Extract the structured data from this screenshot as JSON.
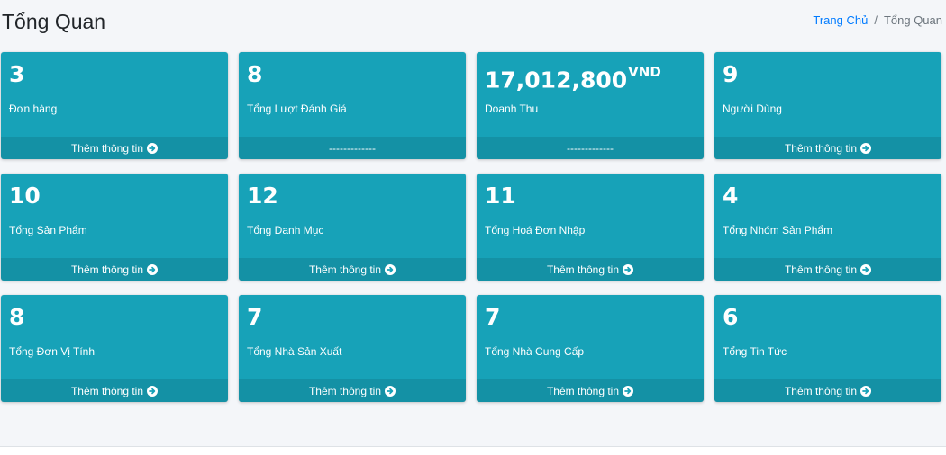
{
  "header": {
    "title": "Tổng Quan",
    "breadcrumb": {
      "home": "Trang Chủ",
      "separator": "/",
      "current": "Tổng Quan"
    }
  },
  "colors": {
    "card_bg": "#17a2b8",
    "link": "#007bff"
  },
  "cards": [
    {
      "value": "3",
      "unit": "",
      "label": "Đơn hàng",
      "footer": "Thêm thông tin",
      "icon": "arrow-circle-right-icon"
    },
    {
      "value": "8",
      "unit": "",
      "label": "Tổng Lượt Đánh Giá",
      "footer": "-------------",
      "icon": ""
    },
    {
      "value": "17,012,800",
      "unit": "VND",
      "label": "Doanh Thu",
      "footer": "-------------",
      "icon": ""
    },
    {
      "value": "9",
      "unit": "",
      "label": "Người Dùng",
      "footer": "Thêm thông tin",
      "icon": "arrow-circle-right-icon"
    },
    {
      "value": "10",
      "unit": "",
      "label": "Tổng Sản Phẩm",
      "footer": "Thêm thông tin",
      "icon": "arrow-circle-right-icon"
    },
    {
      "value": "12",
      "unit": "",
      "label": "Tổng Danh Mục",
      "footer": "Thêm thông tin",
      "icon": "arrow-circle-right-icon"
    },
    {
      "value": "11",
      "unit": "",
      "label": "Tổng Hoá Đơn Nhập",
      "footer": "Thêm thông tin",
      "icon": "arrow-circle-right-icon"
    },
    {
      "value": "4",
      "unit": "",
      "label": "Tổng Nhóm Sản Phẩm",
      "footer": "Thêm thông tin",
      "icon": "arrow-circle-right-icon"
    },
    {
      "value": "8",
      "unit": "",
      "label": "Tổng Đơn Vị Tính",
      "footer": "Thêm thông tin",
      "icon": "arrow-circle-right-icon"
    },
    {
      "value": "7",
      "unit": "",
      "label": "Tổng Nhà Sản Xuất",
      "footer": "Thêm thông tin",
      "icon": "arrow-circle-right-icon"
    },
    {
      "value": "7",
      "unit": "",
      "label": "Tổng Nhà Cung Cấp",
      "footer": "Thêm thông tin",
      "icon": "arrow-circle-right-icon"
    },
    {
      "value": "6",
      "unit": "",
      "label": "Tổng Tin Tức",
      "footer": "Thêm thông tin",
      "icon": "arrow-circle-right-icon"
    }
  ]
}
